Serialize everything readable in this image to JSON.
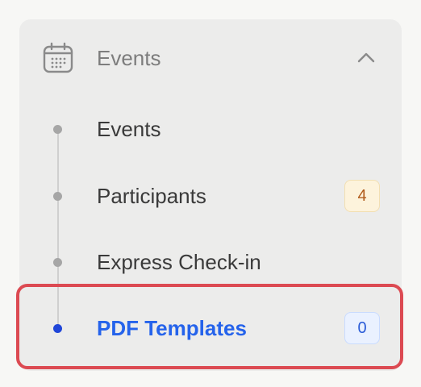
{
  "group": {
    "title": "Events",
    "icon": "calendar-icon",
    "expanded": true,
    "chevron_icon": "chevron-up-icon"
  },
  "items": [
    {
      "label": "Events",
      "badge": null,
      "active": false
    },
    {
      "label": "Participants",
      "badge": "4",
      "badge_style": "warning",
      "active": false
    },
    {
      "label": "Express Check-in",
      "badge": null,
      "active": false
    },
    {
      "label": "PDF Templates",
      "badge": "0",
      "badge_style": "info",
      "active": true
    }
  ],
  "colors": {
    "accent": "#2563eb",
    "highlight_border": "#dc4a52",
    "warning_badge_text": "#b05a1a"
  }
}
